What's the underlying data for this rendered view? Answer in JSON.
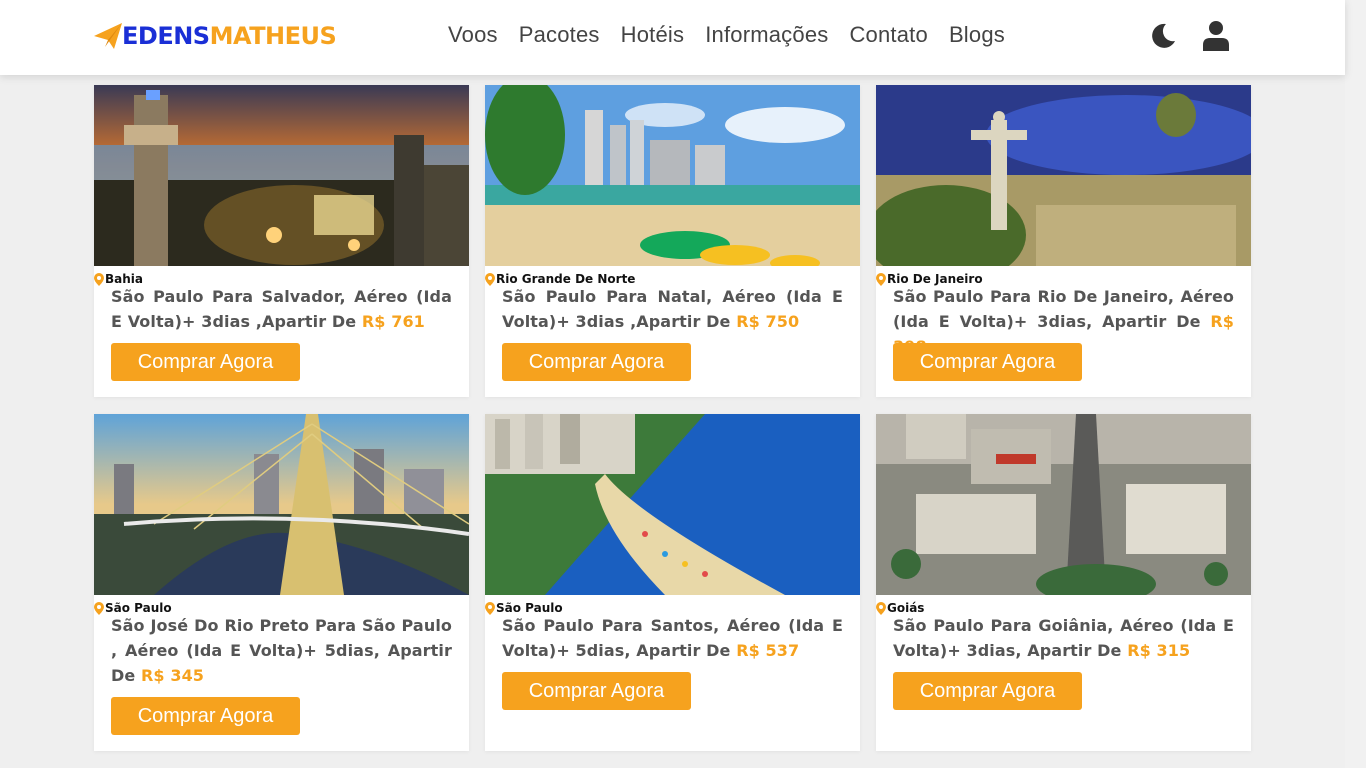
{
  "header": {
    "logo_part1": "EDENS",
    "logo_part2": "MATHEUS",
    "nav": [
      "Voos",
      "Pacotes",
      "Hotéis",
      "Informações",
      "Contato",
      "Blogs"
    ],
    "icons": [
      "moon-icon",
      "user-icon"
    ]
  },
  "colors": {
    "accent": "#f6a21e",
    "brand_blue": "#1a2fd6"
  },
  "cards": [
    {
      "location": "Bahia",
      "text": "São Paulo Para Salvador, Aéreo (Ida E Volta)+ 3dias ,Apartir De ",
      "price": "R$ 761",
      "button": "Comprar Agora"
    },
    {
      "location": "Rio Grande De Norte",
      "text": "São Paulo Para Natal, Aéreo (Ida E Volta)+ 3dias ,Apartir De ",
      "price": "R$ 750",
      "button": "Comprar Agora"
    },
    {
      "location": "Rio De Janeiro",
      "text": "São Paulo Para Rio De Janeiro, Aéreo (Ida E Volta)+ 3dias, Apartir De ",
      "price": "R$ 398",
      "button": "Comprar Agora"
    },
    {
      "location": "São Paulo",
      "text": "São José Do Rio Preto Para São Paulo , Aéreo (Ida E Volta)+ 5dias, Apartir De ",
      "price": "R$ 345",
      "button": "Comprar Agora"
    },
    {
      "location": "São Paulo",
      "text": "São Paulo Para Santos, Aéreo (Ida E Volta)+ 5dias, Apartir De ",
      "price": "R$ 537",
      "button": "Comprar Agora"
    },
    {
      "location": "Goiás",
      "text": "São Paulo Para Goiânia, Aéreo (Ida E Volta)+ 3dias, Apartir De ",
      "price": "R$ 315",
      "button": "Comprar Agora"
    }
  ]
}
